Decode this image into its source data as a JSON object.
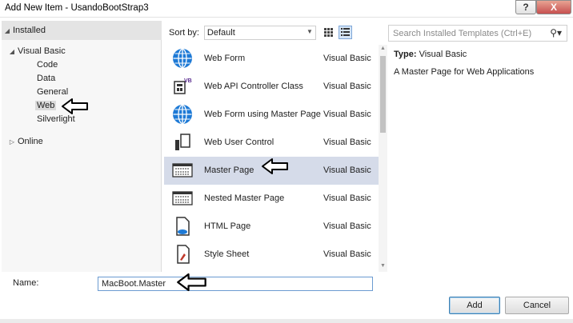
{
  "window": {
    "title": "Add New Item - UsandoBootStrap3",
    "help_label": "?",
    "close_label": "X"
  },
  "sidebar": {
    "installed_label": "Installed",
    "visual_basic_label": "Visual Basic",
    "items": [
      {
        "label": "Code"
      },
      {
        "label": "Data"
      },
      {
        "label": "General"
      },
      {
        "label": "Web"
      },
      {
        "label": "Silverlight"
      }
    ],
    "online_label": "Online"
  },
  "toolbar": {
    "sort_by_label": "Sort by:",
    "sort_value": "Default",
    "search_placeholder": "Search Installed Templates (Ctrl+E)"
  },
  "templates": [
    {
      "name": "Web Form",
      "lang": "Visual Basic",
      "icon": "globe-icon"
    },
    {
      "name": "Web API Controller Class",
      "lang": "Visual Basic",
      "icon": "vb-class-icon"
    },
    {
      "name": "Web Form using Master Page",
      "lang": "Visual Basic",
      "icon": "globe-icon"
    },
    {
      "name": "Web User Control",
      "lang": "Visual Basic",
      "icon": "user-control-icon"
    },
    {
      "name": "Master Page",
      "lang": "Visual Basic",
      "icon": "master-page-icon",
      "selected": true
    },
    {
      "name": "Nested Master Page",
      "lang": "Visual Basic",
      "icon": "master-page-icon"
    },
    {
      "name": "HTML Page",
      "lang": "Visual Basic",
      "icon": "html-page-icon"
    },
    {
      "name": "Style Sheet",
      "lang": "Visual Basic",
      "icon": "style-sheet-icon"
    }
  ],
  "details": {
    "type_label": "Type:",
    "type_value": "Visual Basic",
    "description": "A Master Page for Web Applications"
  },
  "form": {
    "name_label": "Name:",
    "name_value": "MacBoot.Master"
  },
  "buttons": {
    "add_label": "Add",
    "cancel_label": "Cancel"
  },
  "colors": {
    "selection": "#d5dbe9",
    "globe_blue": "#1e7ad6",
    "close_red": "#c75050"
  }
}
